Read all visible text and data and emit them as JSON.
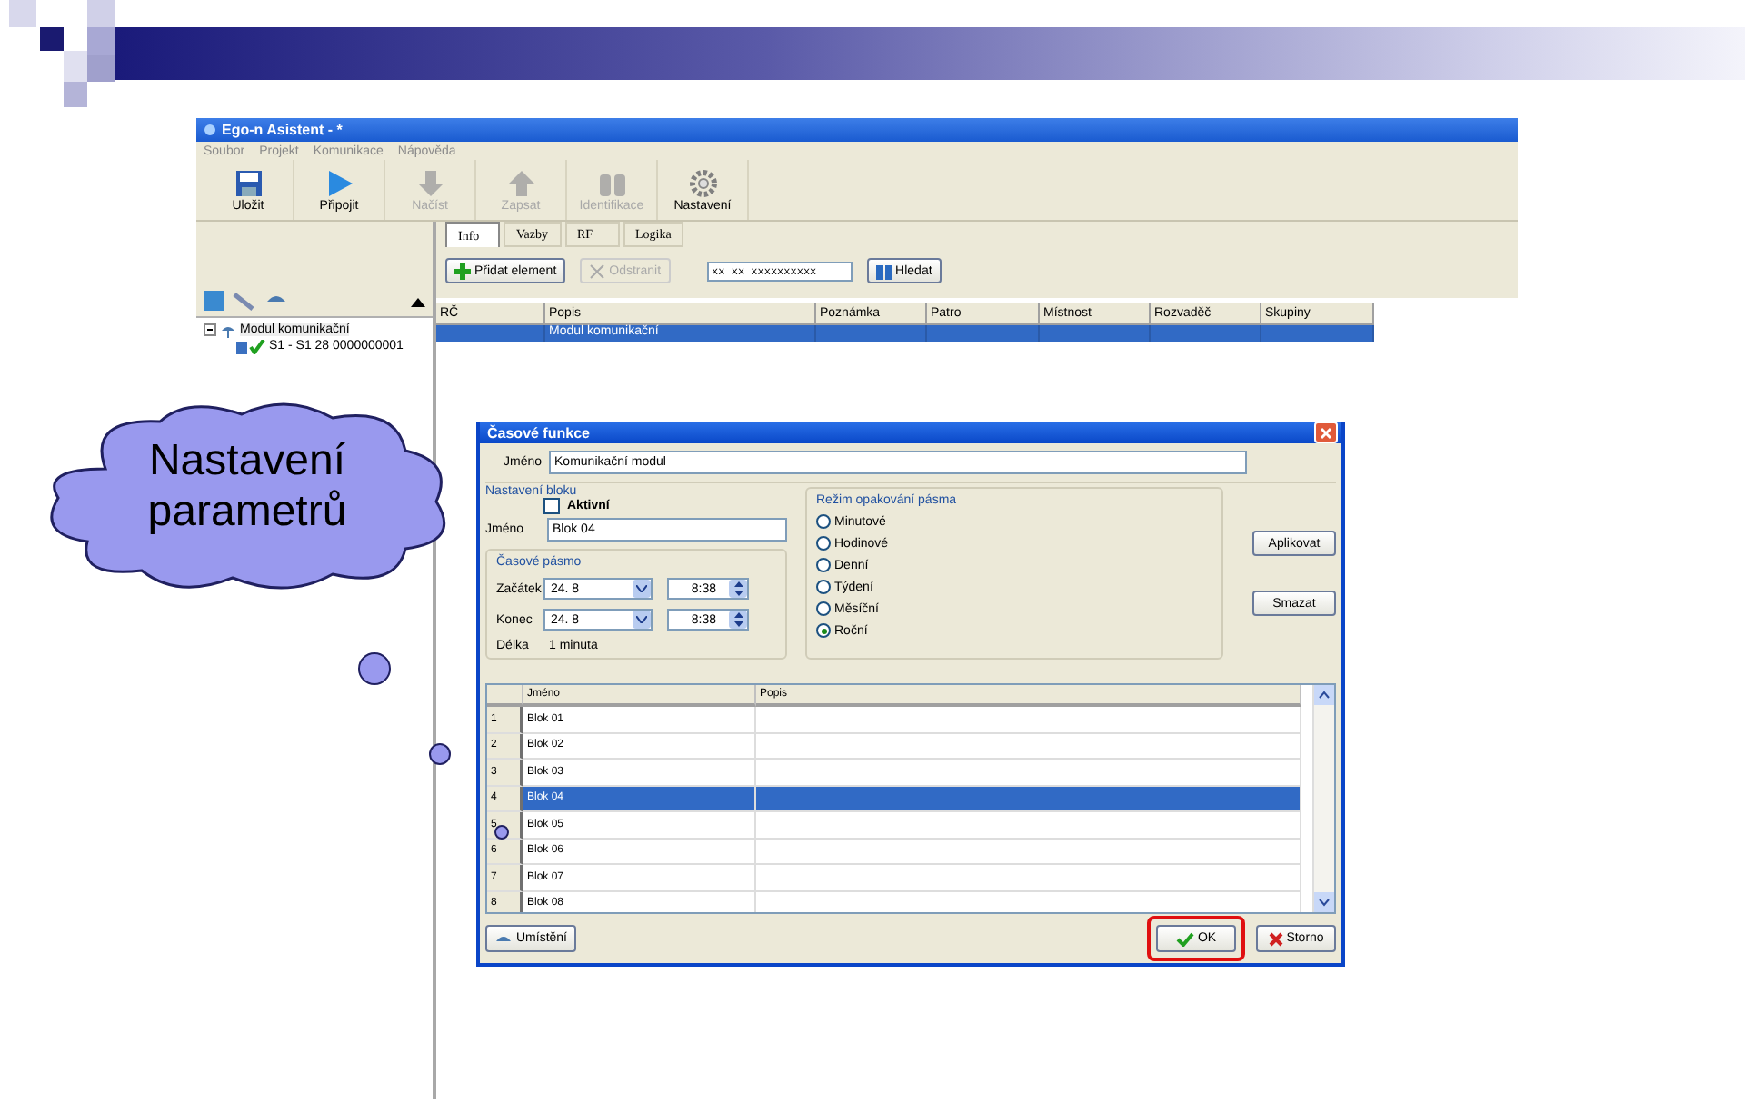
{
  "callout": {
    "lines": [
      "Nastavení",
      "parametrů"
    ]
  },
  "app": {
    "title": "Ego-n Asistent - *",
    "menu": [
      "Soubor",
      "Projekt",
      "Komunikace",
      "Nápověda"
    ],
    "toolbar": [
      {
        "label": "Uložit",
        "disabled": false
      },
      {
        "label": "Připojit",
        "disabled": false
      },
      {
        "label": "Načíst",
        "disabled": true
      },
      {
        "label": "Zapsat",
        "disabled": true
      },
      {
        "label": "Identifikace",
        "disabled": true
      },
      {
        "label": "Nastavení",
        "disabled": false
      }
    ],
    "tree": [
      {
        "label": "Modul komunikační",
        "expanded": true,
        "children": [
          {
            "label": "S1 - S1 28 0000000001"
          }
        ]
      }
    ],
    "tabs": [
      {
        "label": "Info",
        "selected": true
      },
      {
        "label": "Vazby",
        "selected": false
      },
      {
        "label": "RF",
        "selected": false
      },
      {
        "label": "Logika",
        "selected": false
      }
    ],
    "actions": [
      {
        "label": "Přidat element",
        "disabled": false
      },
      {
        "label": "Odstranit",
        "disabled": true
      }
    ],
    "search": {
      "value": "xx xx xxxxxxxxxx"
    },
    "search_button": "Hledat",
    "table": {
      "columns": [
        "RČ",
        "Popis",
        "Poznámka",
        "Patro",
        "Místnost",
        "Rozvaděč",
        "Skupiny"
      ],
      "rows": [
        {
          "cells": [
            "",
            "Modul komunikační",
            "",
            "",
            "",
            "",
            ""
          ],
          "selected": true
        }
      ]
    }
  },
  "dialog": {
    "title": "Časové funkce",
    "name_label": "Jméno",
    "name_value": "Komunikační modul",
    "block_group": "Nastavení bloku",
    "active": {
      "label": "Aktivní",
      "checked": false
    },
    "block_name_label": "Jméno",
    "block_name_value": "Blok 04",
    "range_group": "Časové pásmo",
    "start": {
      "label": "Začátek",
      "date": "24. 8",
      "time": "8:38"
    },
    "end": {
      "label": "Konec",
      "date": "24. 8",
      "time": "8:38"
    },
    "length": {
      "label": "Délka",
      "value": "1 minuta"
    },
    "mode_group": "Režim opakování pásma",
    "modes": [
      {
        "label": "Minutové",
        "selected": false
      },
      {
        "label": "Hodinové",
        "selected": false
      },
      {
        "label": "Denní",
        "selected": false
      },
      {
        "label": "Týdení",
        "selected": false
      },
      {
        "label": "Měsíční",
        "selected": false
      },
      {
        "label": "Roční",
        "selected": true
      }
    ],
    "side_buttons": [
      "Aplikovat",
      "Smazat"
    ],
    "grid": {
      "columns": [
        "",
        "Jméno",
        "Popis"
      ],
      "rows": [
        {
          "index": "1",
          "name": "Blok 01",
          "selected": false
        },
        {
          "index": "2",
          "name": "Blok 02",
          "selected": false
        },
        {
          "index": "3",
          "name": "Blok 03",
          "selected": false
        },
        {
          "index": "4",
          "name": "Blok 04",
          "selected": true
        },
        {
          "index": "5",
          "name": "Blok 05",
          "selected": false
        },
        {
          "index": "6",
          "name": "Blok 06",
          "selected": false
        },
        {
          "index": "7",
          "name": "Blok 07",
          "selected": false
        },
        {
          "index": "8",
          "name": "Blok 08",
          "selected": false
        }
      ]
    },
    "footer_left": "Umístění",
    "ok": {
      "label": "OK",
      "highlighted": true
    },
    "cancel": "Storno"
  }
}
